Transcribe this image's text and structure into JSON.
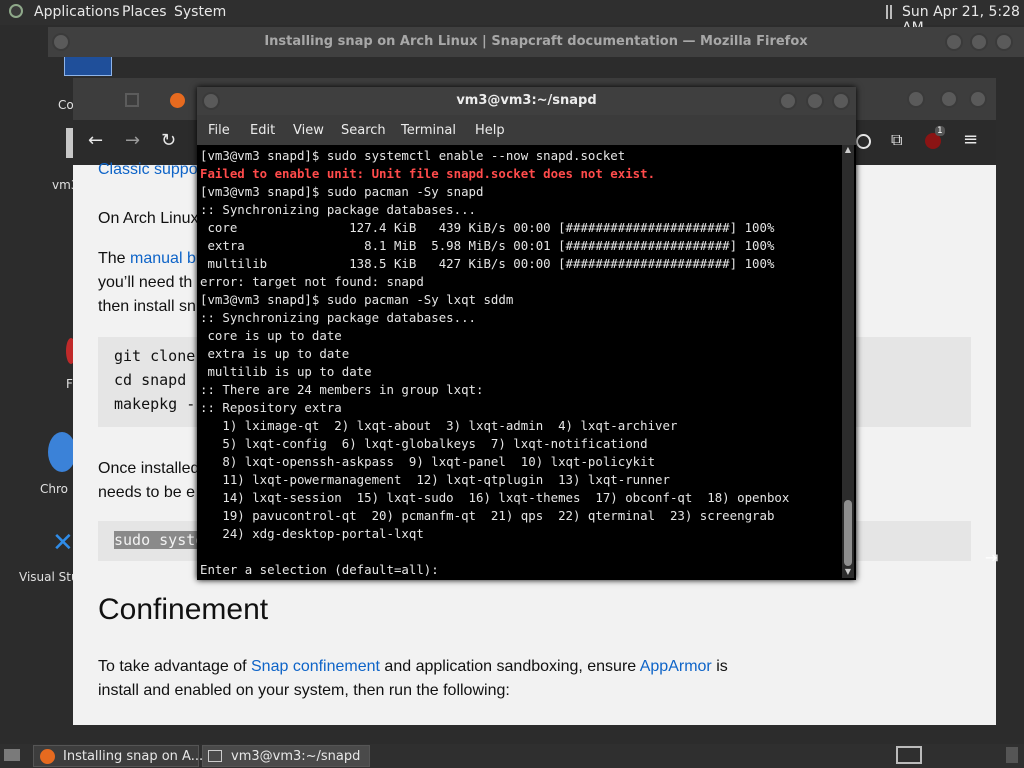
{
  "top_panel": {
    "menus": [
      "Applications",
      "Places",
      "System"
    ],
    "clock": "Sun Apr 21, 5:28 AM"
  },
  "desktop_icons": [
    "Co",
    "vm3",
    "F",
    "Chro",
    "Visual Stu"
  ],
  "firefox": {
    "title": "Installing snap on Arch Linux | Snapcraft documentation — Mozilla Firefox",
    "extension_badge": "1",
    "content": {
      "classic_support": "Classic suppor",
      "on_arch": "On Arch Linux",
      "manual_pre": "The ",
      "manual_link": "manual bu",
      "youll_need": "you’ll need th",
      "then_install": "then install sn",
      "code1": [
        "git clone",
        "cd snapd",
        "makepkg -"
      ],
      "once_installed": "Once installed",
      "needs_to_be": "needs to be e",
      "code2": "sudo syste",
      "heading": "Confinement",
      "conf_pre": "To take advantage of ",
      "conf_link1": "Snap confinement",
      "conf_mid": " and application sandboxing, ensure ",
      "conf_link2": "AppArmor",
      "conf_post": " is",
      "conf_line2": "install and enabled on your system, then run the following:"
    }
  },
  "terminal": {
    "title": "vm3@vm3:~/snapd",
    "menu": [
      "File",
      "Edit",
      "View",
      "Search",
      "Terminal",
      "Help"
    ],
    "lines": [
      {
        "text": "[vm3@vm3 snapd]$ sudo systemctl enable --now snapd.socket",
        "err": false
      },
      {
        "text": "Failed to enable unit: Unit file snapd.socket does not exist.",
        "err": true
      },
      {
        "text": "[vm3@vm3 snapd]$ sudo pacman -Sy snapd",
        "err": false
      },
      {
        "text": ":: Synchronizing package databases...",
        "err": false
      },
      {
        "text": " core               127.4 KiB   439 KiB/s 00:00 [######################] 100%",
        "err": false
      },
      {
        "text": " extra                8.1 MiB  5.98 MiB/s 00:01 [######################] 100%",
        "err": false
      },
      {
        "text": " multilib           138.5 KiB   427 KiB/s 00:00 [######################] 100%",
        "err": false
      },
      {
        "text": "error: target not found: snapd",
        "err": false
      },
      {
        "text": "[vm3@vm3 snapd]$ sudo pacman -Sy lxqt sddm",
        "err": false
      },
      {
        "text": ":: Synchronizing package databases...",
        "err": false
      },
      {
        "text": " core is up to date",
        "err": false
      },
      {
        "text": " extra is up to date",
        "err": false
      },
      {
        "text": " multilib is up to date",
        "err": false
      },
      {
        "text": ":: There are 24 members in group lxqt:",
        "err": false
      },
      {
        "text": ":: Repository extra",
        "err": false
      },
      {
        "text": "   1) lximage-qt  2) lxqt-about  3) lxqt-admin  4) lxqt-archiver",
        "err": false
      },
      {
        "text": "   5) lxqt-config  6) lxqt-globalkeys  7) lxqt-notificationd",
        "err": false
      },
      {
        "text": "   8) lxqt-openssh-askpass  9) lxqt-panel  10) lxqt-policykit",
        "err": false
      },
      {
        "text": "   11) lxqt-powermanagement  12) lxqt-qtplugin  13) lxqt-runner",
        "err": false
      },
      {
        "text": "   14) lxqt-session  15) lxqt-sudo  16) lxqt-themes  17) obconf-qt  18) openbox",
        "err": false
      },
      {
        "text": "   19) pavucontrol-qt  20) pcmanfm-qt  21) qps  22) qterminal  23) screengrab",
        "err": false
      },
      {
        "text": "   24) xdg-desktop-portal-lxqt",
        "err": false
      },
      {
        "text": "",
        "err": false
      },
      {
        "text": "Enter a selection (default=all): ",
        "err": false
      }
    ]
  },
  "taskbar": {
    "firefox_task": "Installing snap on A...",
    "terminal_task": "vm3@vm3:~/snapd"
  }
}
